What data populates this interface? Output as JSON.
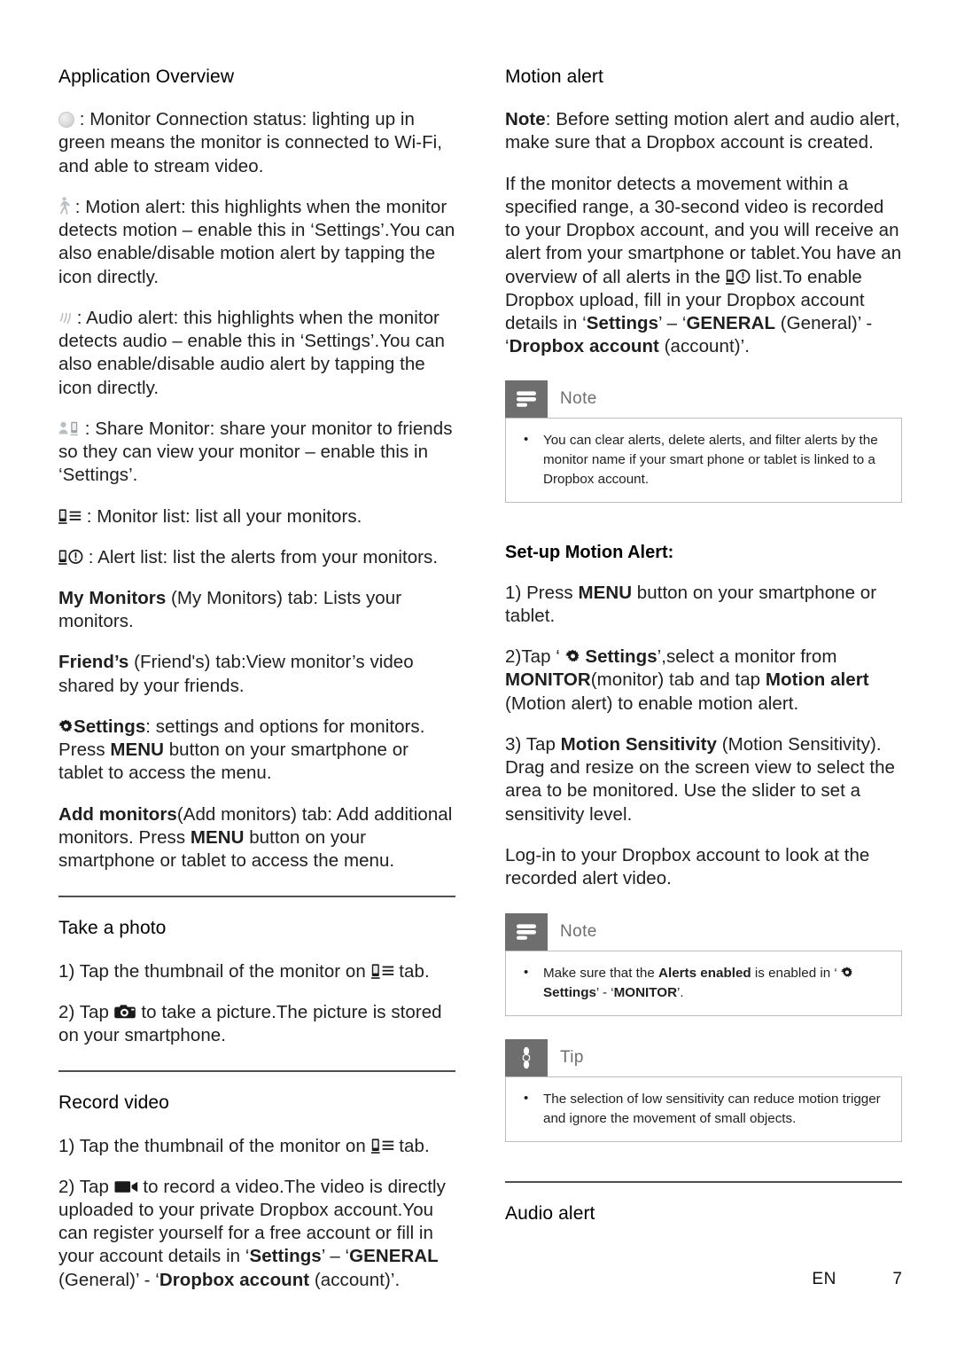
{
  "page": {
    "footer_language": "EN",
    "footer_page_number": "7"
  },
  "colors": {
    "text": "#1f1f1f",
    "callout_badge_bg": "#6e6e6e",
    "callout_label": "#6e6e6e",
    "callout_border": "#bdbdbd",
    "rule": "#4f4f4f",
    "icon_light": "#b9bfc2",
    "icon_dark": "#1a1a1a"
  },
  "left_column": {
    "heading": "Application Overview",
    "paragraphs": {
      "led_status": {
        "icon": "led-circle-icon",
        "text": " : Monitor Connection status: lighting up in green means the monitor is connected to Wi-Fi, and able to stream video."
      },
      "motion_alert": {
        "icon": "motion-person-icon",
        "text": " : Motion alert: this highlights when the monitor detects motion – enable this in ‘Settings’.You can also enable/disable motion alert by tapping the icon directly."
      },
      "audio_alert": {
        "icon": "audio-waves-icon",
        "text": " : Audio alert: this highlights when the monitor detects audio – enable this in ‘Settings’.You can also enable/disable audio alert by tapping the icon directly."
      },
      "share_monitor": {
        "icon": "share-monitor-icon",
        "text": " : Share Monitor: share your monitor to friends so they can view your monitor – enable this in ‘Settings’."
      },
      "monitor_list": {
        "icon": "monitor-list-icon",
        "text": " : Monitor list: list all your monitors."
      },
      "alert_list": {
        "icon": "alert-list-icon",
        "text": " : Alert list: list the alerts from your monitors."
      },
      "my_monitors": {
        "bold": "My Monitors",
        "rest": " (My Monitors) tab: Lists your monitors."
      },
      "friends": {
        "bold": "Friend’s",
        "rest": " (Friend's) tab:View monitor’s video shared by your friends."
      },
      "settings": {
        "icon": "gear-icon",
        "bold": "Settings",
        "mid": ": settings and options for monitors. Press ",
        "bold2": "MENU",
        "rest": " button on your smartphone or tablet to access the menu."
      },
      "add_monitors": {
        "bold": "Add monitors",
        "mid": "(Add monitors) tab: Add additional monitors. Press ",
        "bold2": "MENU",
        "rest": " button on your smartphone or tablet to access the menu."
      }
    },
    "take_a_photo": {
      "heading": "Take a photo",
      "step1_a": "1) Tap the thumbnail of the monitor on ",
      "step1_icon": "monitor-list-icon",
      "step1_b": " tab.",
      "step2_a": "2) Tap ",
      "step2_icon": "camera-icon",
      "step2_b": " to take a picture.The picture is stored on your smartphone."
    },
    "record_video": {
      "heading": "Record video",
      "step1_a": "1) Tap the thumbnail of the monitor on ",
      "step1_icon": "monitor-list-icon",
      "step1_b": " tab.",
      "step2_a": "2) Tap ",
      "step2_icon": "video-icon",
      "step2_b": " to record a video.The video is directly uploaded to your private Dropbox account.You can register yourself for a free account or fill in your account details in ‘",
      "step2_bold1": "Settings",
      "step2_c": "’ – ‘",
      "step2_bold2": "GENERAL",
      "step2_d": " (General)’ - ‘",
      "step2_bold3": "Dropbox account",
      "step2_e": " (account)’."
    }
  },
  "right_column": {
    "motion_alert": {
      "heading": "Motion alert",
      "note_bold": "Note",
      "note_rest": ": Before setting motion alert and audio alert, make sure that a Dropbox account is created.",
      "body_a": "If the monitor detects a movement within a specified range, a 30-second video is recorded to your Dropbox account, and you will receive an alert from your smartphone or tablet.You have an overview of all alerts in the ",
      "body_icon": "alert-list-icon",
      "body_b": " list.To enable Dropbox upload, fill in your Dropbox account details in ‘",
      "body_bold1": "Settings",
      "body_c": "’ – ‘",
      "body_bold2": "GENERAL",
      "body_d": " (General)’ - ‘",
      "body_bold3": "Dropbox account",
      "body_e": " (account)’."
    },
    "note_box_1": {
      "icon": "note-icon",
      "label": "Note",
      "items": [
        "You can clear alerts, delete alerts, and filter alerts by the monitor name if your smart phone or tablet is linked to a Dropbox account."
      ]
    },
    "setup_motion_alert": {
      "heading": "Set-up Motion Alert:",
      "step1_a": "1) Press ",
      "step1_bold": "MENU",
      "step1_b": " button on your smartphone or tablet.",
      "step2_a": "2)Tap ‘ ",
      "step2_icon": "gear-icon",
      "step2_bold1": " Settings",
      "step2_b": "’,select a monitor from ",
      "step2_bold2": "MONITOR",
      "step2_c": "(monitor) tab and tap ",
      "step2_bold3": "Motion alert",
      "step2_d": " (Motion alert) to enable motion alert.",
      "step3_a": "3) Tap ",
      "step3_bold": "Motion Sensitivity",
      "step3_b": " (Motion Sensitivity). Drag and resize on the screen view to select the area to be monitored. Use the slider to set a sensitivity level.",
      "step4": "Log-in to your Dropbox account to look at the recorded alert video."
    },
    "note_box_2": {
      "icon": "note-icon",
      "label": "Note",
      "item_a": "Make sure that the ",
      "item_bold1": "Alerts enabled",
      "item_b": " is enabled in ‘ ",
      "item_icon": "gear-icon",
      "item_bold2": "Settings",
      "item_c": "’ - ‘",
      "item_bold3": "MONITOR",
      "item_d": "’."
    },
    "tip_box": {
      "icon": "tip-star-icon",
      "label": "Tip",
      "items": [
        "The selection of low sensitivity can reduce motion trigger and ignore the movement of small objects."
      ]
    },
    "audio_alert": {
      "heading": "Audio alert"
    }
  }
}
